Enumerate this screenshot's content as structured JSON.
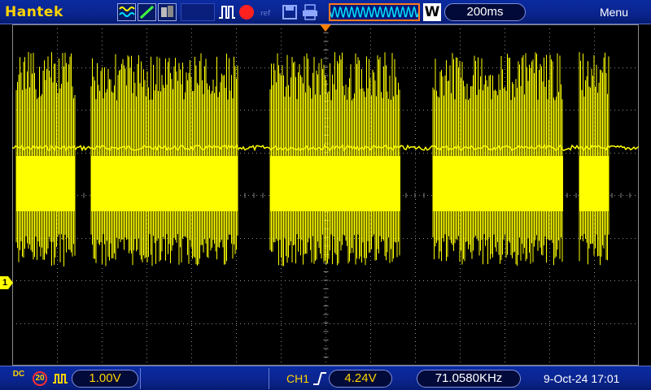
{
  "header": {
    "brand": "Hantek",
    "timebase": "200ms",
    "mode_label": "W",
    "menu_label": "Menu",
    "icons": [
      "auto-mode-icon",
      "normal-mode-icon",
      "single-mode-icon",
      "trigger-waveform-icon",
      "record-icon",
      "small-icon",
      "save-icon",
      "print-icon",
      "timebase-waveform-icon"
    ]
  },
  "channel": {
    "marker": "1",
    "coupling": "DC",
    "bandwidth_limit": "20",
    "volts_per_div": "1.00V"
  },
  "trigger": {
    "source": "CH1",
    "level": "4.24V"
  },
  "frequency": "71.0580KHz",
  "datetime": "9-Oct-24 17:01",
  "colors": {
    "trace": "#ffff00",
    "toolbar": "#0b2590",
    "grid": "#8a8a8a",
    "brand": "#ffd400"
  }
}
